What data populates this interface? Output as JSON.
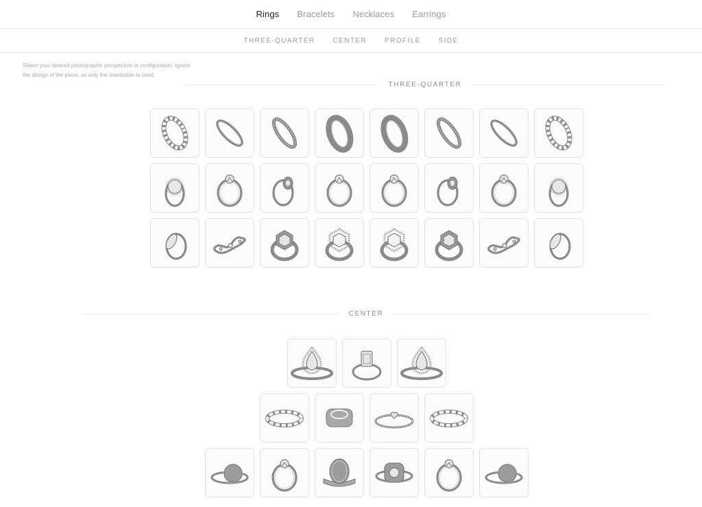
{
  "top_tabs": [
    {
      "label": "Rings",
      "active": true
    },
    {
      "label": "Bracelets",
      "active": false
    },
    {
      "label": "Necklaces",
      "active": false
    },
    {
      "label": "Earrings",
      "active": false
    }
  ],
  "sub_tabs": [
    "THREE-QUARTER",
    "CENTER",
    "PROFILE",
    "SIDE"
  ],
  "instructions": "Select your desired photographic perspective or configuration. Ignore the design of the piece, as only the orientation is used.",
  "sections": [
    {
      "title": "THREE-QUARTER",
      "rows": [
        [
          "eternity-ring-icon",
          "thin-band-ring-icon",
          "pave-band-ring-icon",
          "domed-band-ring-icon",
          "domed-band-ring-icon",
          "pave-band-ring-icon",
          "thin-band-ring-icon",
          "eternity-ring-icon"
        ],
        [
          "halo-ring-icon",
          "solitaire-ring-icon",
          "signet-ring-icon",
          "solitaire-ring-icon",
          "solitaire-ring-icon",
          "signet-ring-icon",
          "solitaire-ring-icon",
          "halo-ring-icon"
        ],
        [
          "marquise-ring-icon",
          "twist-ring-icon",
          "hexagon-ring-icon",
          "hexagon-halo-ring-icon",
          "hexagon-halo-ring-icon",
          "hexagon-ring-icon",
          "twist-ring-icon",
          "marquise-ring-icon"
        ]
      ]
    },
    {
      "title": "CENTER",
      "rows": [
        [
          "pear-halo-ring-icon",
          "emerald-cut-ring-icon",
          "pear-halo-ring-icon"
        ],
        [
          "bubble-band-ring-icon",
          "cigar-band-ring-icon",
          "heart-ring-icon",
          "bubble-band-ring-icon"
        ],
        [
          "round-signet-ring-icon",
          "solitaire-ring-icon",
          "oval-signet-ring-icon",
          "cushion-halo-ring-icon",
          "solitaire-ring-icon",
          "round-signet-ring-icon"
        ]
      ]
    }
  ]
}
